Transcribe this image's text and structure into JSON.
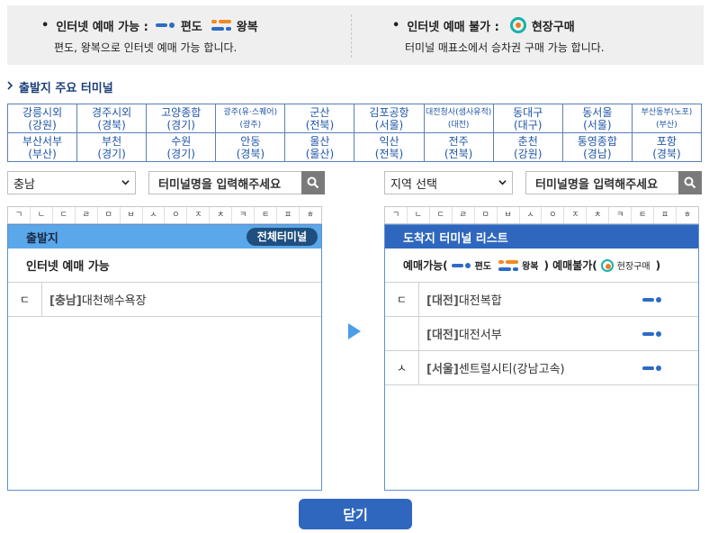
{
  "legend": {
    "bullet": "•",
    "left_title": "인터넷 예매 가능 :",
    "oneway_label": "편도",
    "round_label": "왕복",
    "left_desc": "편도, 왕복으로 인터넷 예매 가능 합니다.",
    "right_title": "인터넷 예매 불가 :",
    "onsite_label": "현장구매",
    "right_desc": "터미널 매표소에서 승차권 구매 가능 합니다."
  },
  "section_title": "출발지 주요 터미널",
  "major_terminals": [
    [
      {
        "name": "강릉시외",
        "region": "(강원)"
      },
      {
        "name": "경주시외",
        "region": "(경북)"
      },
      {
        "name": "고양종합",
        "region": "(경기)"
      },
      {
        "name": "광주(유·스퀘어)",
        "region": "(광주)",
        "small": true
      },
      {
        "name": "군산",
        "region": "(전북)"
      },
      {
        "name": "김포공항",
        "region": "(서울)"
      },
      {
        "name": "대전청사(샘사유적)",
        "region": "(대전)",
        "small": true
      },
      {
        "name": "동대구",
        "region": "(대구)"
      },
      {
        "name": "동서울",
        "region": "(서울)"
      },
      {
        "name": "부산동부(노포)",
        "region": "(부산)",
        "small": true
      }
    ],
    [
      {
        "name": "부산서부",
        "region": "(부산)"
      },
      {
        "name": "부천",
        "region": "(경기)"
      },
      {
        "name": "수원",
        "region": "(경기)"
      },
      {
        "name": "안동",
        "region": "(경북)"
      },
      {
        "name": "울산",
        "region": "(울산)"
      },
      {
        "name": "익산",
        "region": "(전북)"
      },
      {
        "name": "전주",
        "region": "(전북)"
      },
      {
        "name": "춘천",
        "region": "(강원)"
      },
      {
        "name": "통영종합",
        "region": "(경남)"
      },
      {
        "name": "포항",
        "region": "(경북)"
      }
    ]
  ],
  "left": {
    "region_select": "충남",
    "search_placeholder": "터미널명을 입력해주세요",
    "header": "출발지",
    "all_button": "전체터미널",
    "subheader": "인터넷 예매 가능",
    "rows": [
      {
        "initial": "ㄷ",
        "region": "[충남]",
        "name": "대천해수욕장"
      }
    ]
  },
  "right": {
    "region_select": "지역 선택",
    "search_placeholder": "터미널명을 입력해주세요",
    "header": "도착지 터미널 리스트",
    "sub_a": "예매가능(",
    "sub_oneway": "편도",
    "sub_round": "왕복",
    "sub_b": ") 예매불가(",
    "sub_onsite": "현장구매",
    "sub_c": ")",
    "rows": [
      {
        "initial": "ㄷ",
        "region": "[대전]",
        "name": "대전복합"
      },
      {
        "initial": "",
        "region": "[대전]",
        "name": "대전서부"
      },
      {
        "initial": "ㅅ",
        "region": "[서울]",
        "name": "센트럴시티(강남고속)"
      }
    ]
  },
  "consonants": [
    "ㄱ",
    "ㄴ",
    "ㄷ",
    "ㄹ",
    "ㅁ",
    "ㅂ",
    "ㅅ",
    "ㅇ",
    "ㅈ",
    "ㅊ",
    "ㅋ",
    "ㅌ",
    "ㅍ",
    "ㅎ"
  ],
  "close_button": "닫기",
  "colors": {
    "accent": "#2e67bd",
    "light_header": "#5aa7ea",
    "onsite": "#17b2a8",
    "round": "#f08a24"
  }
}
